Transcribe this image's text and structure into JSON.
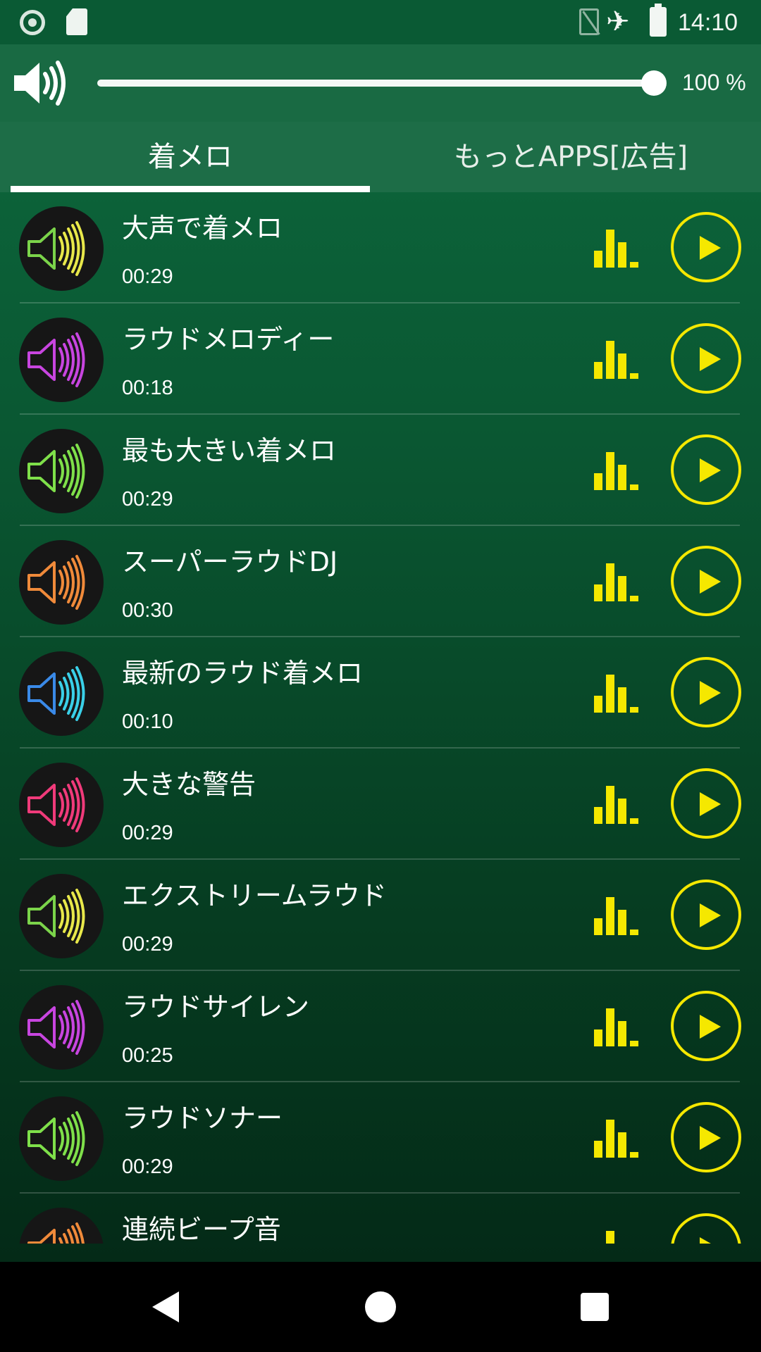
{
  "status_bar": {
    "time": "14:10",
    "icons": [
      "record-icon",
      "sd-card-icon",
      "no-sim-icon",
      "airplane-icon",
      "battery-charging-icon"
    ]
  },
  "volume": {
    "icon": "speaker-icon",
    "percent_label": "100 %",
    "level": 1.0
  },
  "tabs": [
    {
      "label": "着メロ",
      "selected": true
    },
    {
      "label": "もっとAPPS[広告]",
      "selected": false
    }
  ],
  "ringtones": [
    {
      "title": "大声で着メロ",
      "duration": "00:29",
      "color": "#e8e84a",
      "inner": "#7bd44a"
    },
    {
      "title": "ラウドメロディー",
      "duration": "00:18",
      "color": "#c845e0",
      "inner": "#c845e0"
    },
    {
      "title": "最も大きい着メロ",
      "duration": "00:29",
      "color": "#7fe04a",
      "inner": "#7fe04a"
    },
    {
      "title": "スーパーラウドDJ",
      "duration": "00:30",
      "color": "#f08a3a",
      "inner": "#f08a3a"
    },
    {
      "title": "最新のラウド着メロ",
      "duration": "00:10",
      "color": "#3ad0e8",
      "inner": "#3a8ae8"
    },
    {
      "title": "大きな警告",
      "duration": "00:29",
      "color": "#f03a7a",
      "inner": "#f03a7a"
    },
    {
      "title": "エクストリームラウド",
      "duration": "00:29",
      "color": "#e8e84a",
      "inner": "#7bd44a"
    },
    {
      "title": "ラウドサイレン",
      "duration": "00:25",
      "color": "#c845e0",
      "inner": "#c845e0"
    },
    {
      "title": "ラウドソナー",
      "duration": "00:29",
      "color": "#7fe04a",
      "inner": "#7fe04a"
    },
    {
      "title": "連続ビープ音",
      "duration": "",
      "color": "#f08a3a",
      "inner": "#f08a3a"
    }
  ],
  "accent_color": "#f5e800",
  "nav": {
    "back": "back-icon",
    "home": "home-icon",
    "recents": "recents-icon"
  }
}
